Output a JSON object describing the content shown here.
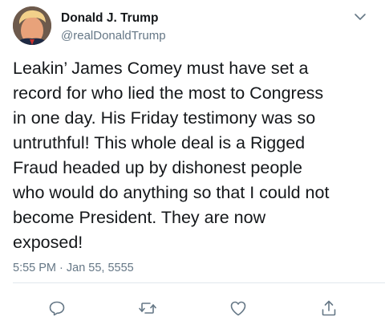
{
  "tweet": {
    "author_name": "Donald J. Trump",
    "author_handle": "@realDonaldTrump",
    "text": "Leakin’ James Comey must have set a\nrecord for who lied the most to Congress\nin one day. His Friday testimony was so\nuntruthful! This whole deal is a Rigged\nFraud headed up by dishonest people\nwho would do anything so that I could not\nbecome President. They are now\nexposed!",
    "timestamp": "5:55 PM · Jan 55, 5555"
  },
  "icons": {
    "menu": "chevron-down-icon",
    "reply": "reply-icon",
    "retweet": "retweet-icon",
    "like": "heart-icon",
    "share": "share-icon"
  },
  "colors": {
    "text": "#14171a",
    "secondary": "#657786",
    "divider": "#e1e8ed"
  }
}
